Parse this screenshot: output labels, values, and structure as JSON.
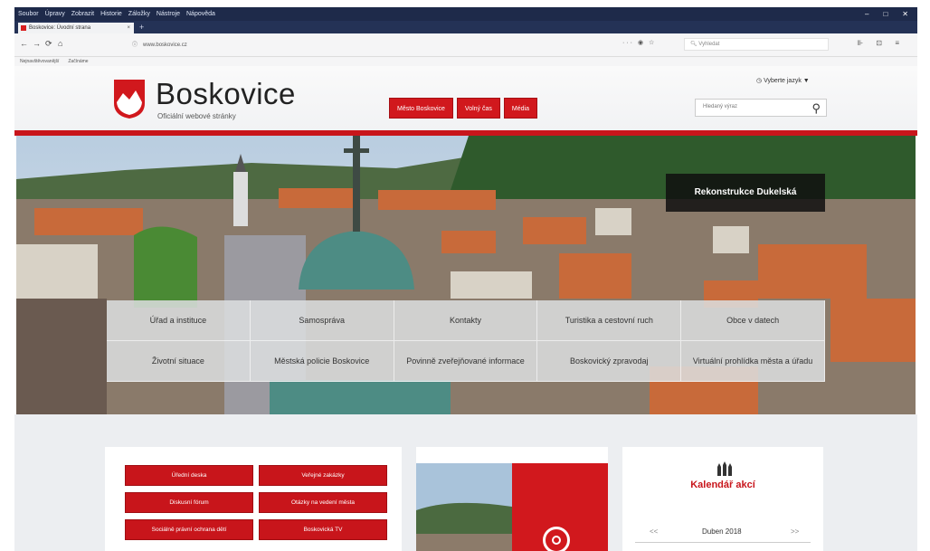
{
  "browser": {
    "menu": [
      "Soubor",
      "Úpravy",
      "Zobrazit",
      "Historie",
      "Záložky",
      "Nástroje",
      "Nápověda"
    ],
    "tab_title": "Boskovice: Úvodní strana",
    "url": "www.boskovice.cz",
    "search_placeholder": "Vyhledat",
    "bookmarks": [
      "Nejnavštěvovanější",
      "Začínáme"
    ],
    "back": "←",
    "forward": "→",
    "reload": "⟳",
    "home": "⌂",
    "page_actions": "··· ◉ ☆",
    "right_actions": "⊪ ⊡ ≡",
    "win_min": "–",
    "win_max": "□",
    "win_close": "✕",
    "new_tab": "+"
  },
  "site": {
    "title": "Boskovice",
    "subtitle": "Oficiální webové stránky",
    "nav": [
      "Město Boskovice",
      "Volný čas",
      "Média"
    ],
    "language": "Vyberte jazyk ▼",
    "search_placeholder": "Hledaný výraz",
    "hero_caption": "Rekonstrukce Dukelská",
    "quick_links": [
      "Úřad a instituce",
      "Samospráva",
      "Kontakty",
      "Turistika a cestovní ruch",
      "Obce v datech",
      "Životní situace",
      "Městská policie Boskovice",
      "Povinně zveřejňované informace",
      "Boskovický zpravodaj",
      "Virtuální prohlídka města a úřadu"
    ],
    "links": [
      "Úřední deska",
      "Veřejné zakázky",
      "Diskusní fórum",
      "Otázky na vedení města",
      "Sociálně právní ochrana dětí",
      "Boskovická TV"
    ],
    "calendar": {
      "title": "Kalendář akcí",
      "month": "Duben 2018",
      "prev": "<<",
      "next": ">>"
    }
  },
  "colors": {
    "brand_red": "#c8151b",
    "chrome_dark": "#1e2a4a"
  }
}
